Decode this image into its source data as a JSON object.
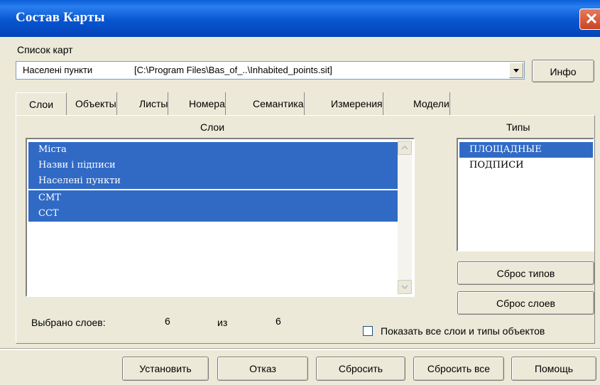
{
  "window": {
    "title": "Состав Карты"
  },
  "map_list": {
    "label": "Список карт",
    "selected_name": "Населені пункти",
    "selected_path": "[C:\\Program Files\\Bas_of_..\\Inhabited_points.sit]",
    "info_button": "Инфо"
  },
  "tabs": [
    "Слои",
    "Объекты",
    "Листы",
    "Номера",
    "Семантика",
    "Измерения",
    "Модели"
  ],
  "active_tab": "Слои",
  "layers": {
    "header": "Слои",
    "items": [
      "Міста",
      "Назви і підписи",
      "Населені пункти",
      "СМТ",
      "ССТ"
    ]
  },
  "types": {
    "header": "Типы",
    "items": [
      "ПЛОЩАДНЫЕ",
      "ПОДПИСИ"
    ],
    "selected_index": 0,
    "reset_types_button": "Сброс типов",
    "reset_layers_button": "Сброс слоев"
  },
  "selection": {
    "label": "Выбрано слоев:",
    "selected_count": "6",
    "of_label": "из",
    "total_count": "6"
  },
  "show_all": {
    "label": "Показать все слои и типы объектов",
    "checked": false
  },
  "footer": {
    "apply": "Установить",
    "cancel": "Отказ",
    "reset": "Сбросить",
    "reset_all": "Сбросить все",
    "help": "Помощь"
  },
  "colors": {
    "title_bar": "#0a5fd8",
    "selection": "#316ac5",
    "dialog_bg": "#ece9d8"
  }
}
